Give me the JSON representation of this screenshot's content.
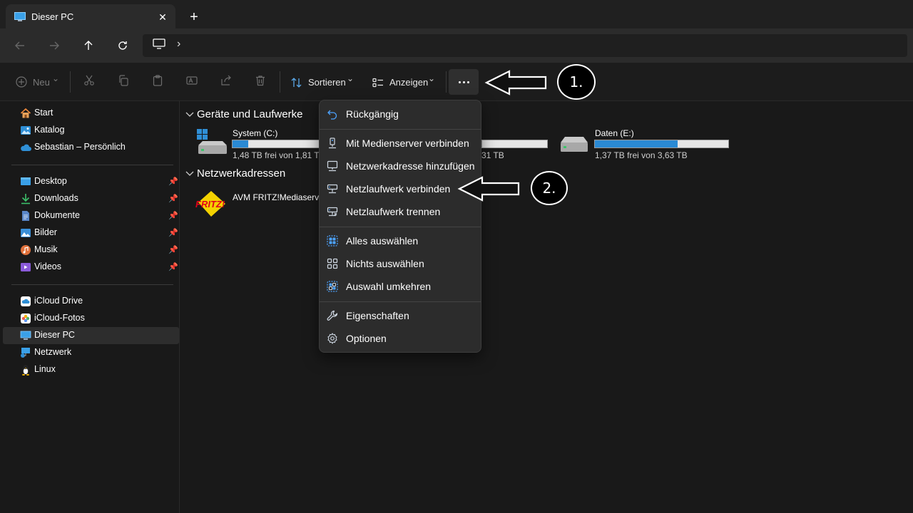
{
  "window": {
    "tab_title": "Dieser PC",
    "tab_close_glyph": "✕",
    "new_tab_glyph": "+"
  },
  "address": {
    "chevron": "›"
  },
  "toolbar": {
    "new_label": "Neu",
    "sort_label": "Sortieren",
    "view_label": "Anzeigen",
    "dropdown_glyph": "⌄"
  },
  "sidebar": {
    "home": "Start",
    "gallery": "Katalog",
    "onedrive": "Sebastian – Persönlich",
    "quick_access": [
      {
        "label": "Desktop"
      },
      {
        "label": "Downloads"
      },
      {
        "label": "Dokumente"
      },
      {
        "label": "Bilder"
      },
      {
        "label": "Musik"
      },
      {
        "label": "Videos"
      }
    ],
    "places": [
      {
        "label": "iCloud Drive"
      },
      {
        "label": "iCloud-Fotos"
      },
      {
        "label": "Dieser PC"
      },
      {
        "label": "Netzwerk"
      },
      {
        "label": "Linux"
      }
    ]
  },
  "main": {
    "devices_header": "Geräte und Laufwerke",
    "network_header": "Netzwerkadressen",
    "drives": [
      {
        "name": "System (C:)",
        "info": "1,48 TB frei von 1,81 TB",
        "used_fraction": 0.18
      },
      {
        "name": "",
        "info": "31 TB",
        "used_fraction": 0.0
      },
      {
        "name": "Daten (E:)",
        "info": "1,37 TB frei von 3,63 TB",
        "used_fraction": 0.62
      }
    ],
    "network_items": [
      {
        "name": "AVM FRITZ!Mediaserv",
        "logo_text": "FRITZ!"
      }
    ]
  },
  "menu": {
    "items": [
      {
        "label": "Rückgängig",
        "icon": "undo-icon"
      },
      {
        "label": "Mit Medienserver verbinden",
        "icon": "media-server-icon"
      },
      {
        "label": "Netzwerkadresse hinzufügen",
        "icon": "network-location-icon"
      },
      {
        "label": "Netzlaufwerk verbinden",
        "icon": "map-drive-icon"
      },
      {
        "label": "Netzlaufwerk trennen",
        "icon": "disconnect-drive-icon"
      },
      {
        "label": "Alles auswählen",
        "icon": "select-all-icon"
      },
      {
        "label": "Nichts auswählen",
        "icon": "select-none-icon"
      },
      {
        "label": "Auswahl umkehren",
        "icon": "invert-selection-icon"
      },
      {
        "label": "Eigenschaften",
        "icon": "properties-icon"
      },
      {
        "label": "Optionen",
        "icon": "options-icon"
      }
    ]
  },
  "annotations": {
    "step1": "1.",
    "step2": "2."
  },
  "colors": {
    "accent": "#2a8ad4",
    "background": "#191919",
    "menu_bg": "#2c2c2c"
  }
}
